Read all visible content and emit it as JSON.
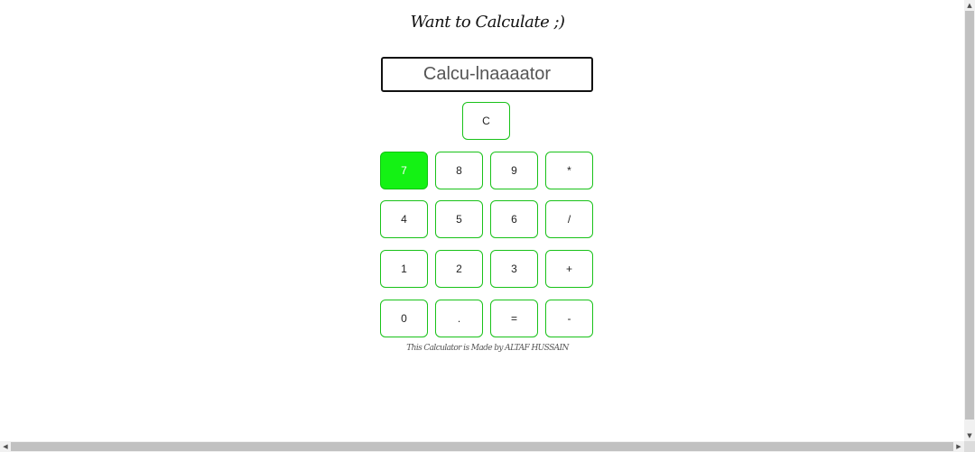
{
  "page": {
    "title": "Want to Calculate ;)",
    "credit": "This Calculator is Made by ALTAF HUSSAIN"
  },
  "display": {
    "placeholder": "Calcu-lnaaaator",
    "value": ""
  },
  "keys": {
    "clear": "C",
    "row1": [
      "7",
      "8",
      "9",
      "*"
    ],
    "row2": [
      "4",
      "5",
      "6",
      "/"
    ],
    "row3": [
      "1",
      "2",
      "3",
      "+"
    ],
    "row4": [
      "0",
      ".",
      "=",
      "-"
    ]
  },
  "state": {
    "highlighted_key": "7"
  },
  "colors": {
    "key_border": "#19c219",
    "key_active_bg": "#14f214",
    "display_border": "#111111"
  },
  "scrollbars": {
    "up_icon": "triangle-up-icon",
    "down_icon": "triangle-down-icon",
    "left_icon": "triangle-left-icon",
    "right_icon": "triangle-right-icon"
  }
}
